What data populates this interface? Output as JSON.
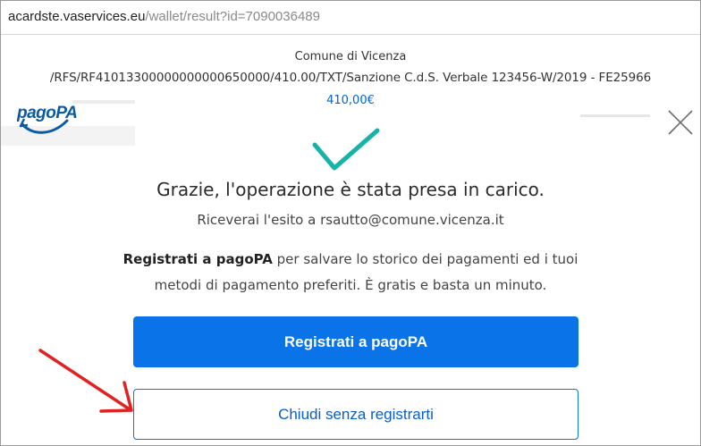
{
  "browser": {
    "url_host": "acardste.vaservices.eu",
    "url_path": "/wallet/result?id=7090036489"
  },
  "payment": {
    "recipient": "Comune di Vicenza",
    "reference": "/RFS/RF41013300000000000650000/410.00/TXT/Sanzione C.d.S. Verbale 123456-W/2019 - FE25966",
    "amount": "410,00€"
  },
  "logo": {
    "text": "pagoPA"
  },
  "result": {
    "title": "Grazie, l'operazione è stata presa in carico.",
    "email_prefix": "Riceverai l'esito a ",
    "email": "rsautto@comune.vicenza.it"
  },
  "promo": {
    "bold": "Registrati a pagoPA",
    "rest": " per salvare lo storico dei pagamenti ed i tuoi metodi di pagamento preferiti. È gratis e basta un minuto."
  },
  "buttons": {
    "register_label": "Registrati a pagoPA",
    "close_label": "Chiudi senza registrarti"
  },
  "icons": {
    "close": "close-icon",
    "check": "checkmark-icon",
    "annotation_arrow": "arrow-annotation-icon"
  },
  "colors": {
    "primary": "#0a73e8",
    "check": "#17b3a8",
    "arrow": "#e02222",
    "amount": "#0066cc"
  }
}
